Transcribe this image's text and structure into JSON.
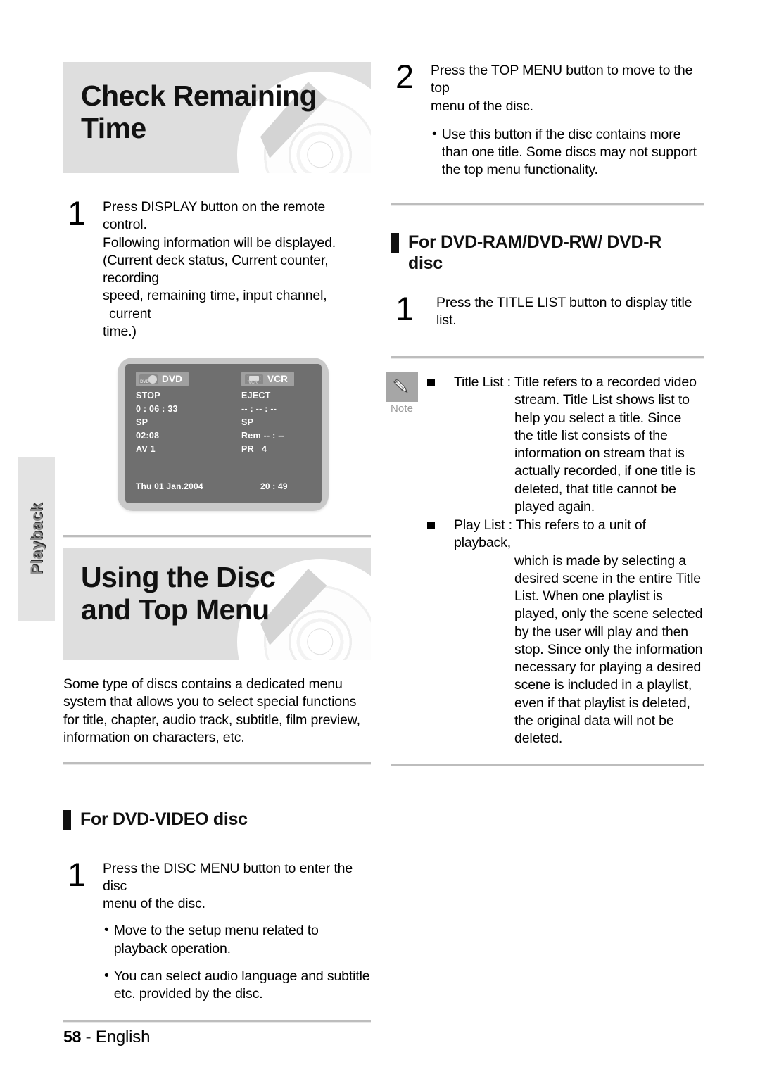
{
  "sidebar": {
    "tab_label": "Playback"
  },
  "footer": {
    "page_number": "58",
    "separator": "-",
    "language": "English"
  },
  "left_column": {
    "banner1": {
      "title": "Check Remaining Time",
      "icon": "disc-graphic"
    },
    "step1": {
      "number": "1",
      "line1": "Press DISPLAY button on the remote control.",
      "line2": "Following information will be displayed.",
      "line3": "(Current deck status, Current counter, recording",
      "line4": "speed, remaining time, input channel, current",
      "line5": "time.)"
    },
    "tv_display": {
      "dvd_panel": {
        "badge_icon": "dvd-disc-icon",
        "badge_label": "DVD",
        "lines": [
          "STOP",
          "0 : 06 : 33",
          "SP",
          "02:08",
          "AV 1"
        ]
      },
      "vcr_panel": {
        "badge_icon": "vcr-cassette-icon",
        "badge_label": "VCR",
        "lines": [
          "EJECT",
          "-- : -- : --",
          "SP",
          "Rem -- : --",
          "PR   4"
        ]
      },
      "date": "Thu 01 Jan.2004",
      "clock": "20 : 49"
    },
    "banner2": {
      "title": "Using the Disc and Top Menu",
      "icon": "disc-graphic"
    },
    "intro_paragraph": "Some type of discs contains a dedicated menu system that allows you to select special functions for title, chapter, audio track, subtitle, film preview, information on characters, etc.",
    "section_dvd_video": {
      "heading": "For DVD-VIDEO disc",
      "step": {
        "number": "1",
        "line1": "Press the DISC MENU button to enter the disc",
        "line2": "menu of the disc."
      },
      "bullets": [
        "Move to the setup menu related to playback operation.",
        "You can select audio language and subtitle etc. provided by the disc."
      ],
      "bullet_marker": "•"
    }
  },
  "right_column": {
    "step2": {
      "number": "2",
      "line1": "Press the TOP MENU button to move to the top",
      "line2": "menu of the disc.",
      "bullet_marker": "•",
      "bullet": "Use this button if the disc contains more than one title. Some discs may not support the top menu functionality."
    },
    "section_dvd_ram": {
      "heading_line1": "For DVD-RAM/DVD-RW/ DVD-R",
      "heading_line2": "disc",
      "step": {
        "number": "1",
        "text": "Press the TITLE LIST button to display title list."
      }
    },
    "note": {
      "icon": "pencil-icon",
      "label": "Note",
      "items": [
        {
          "marker": "square-bullet",
          "lead": "Title List : Title refers to a recorded video",
          "continuation": "stream. Title List shows list to help you select a title. Since the title list consists of the information on stream that is actually recorded, if one title is deleted, that title cannot be played again."
        },
        {
          "marker": "square-bullet",
          "lead": "Play List : This refers to a unit of playback,",
          "continuation": "which is made by selecting a desired scene in the entire Title List. When one playlist is played, only the scene selected by the user will play and then stop. Since only the information necessary for playing a desired scene is included in a playlist, even if that playlist is deleted, the original data will not be deleted."
        }
      ]
    }
  },
  "colors": {
    "banner_bg": "#dedede",
    "tab_bg": "#e3e3e3",
    "tv_frame": "#c9c9c9",
    "tv_screen": "#6f6f6f",
    "note_icon_bg": "#a6a6a6",
    "rule": "#bdbdbd"
  }
}
